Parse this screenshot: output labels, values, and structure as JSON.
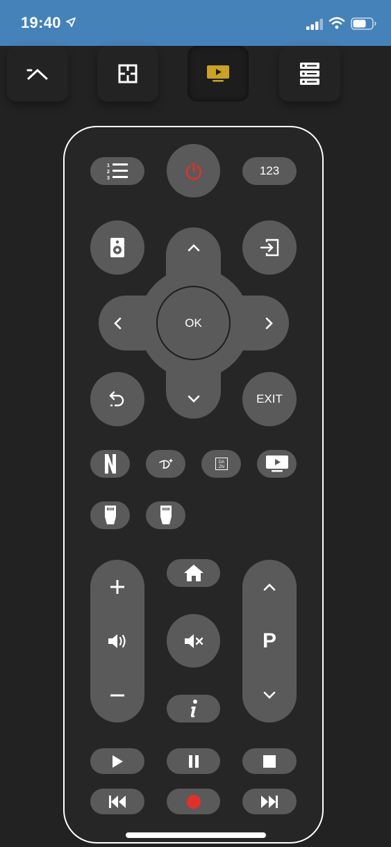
{
  "status_bar": {
    "time": "19:40"
  },
  "remote": {
    "numbers_label": "123",
    "ok_label": "OK",
    "exit_label": "EXIT",
    "channel_label": "P",
    "dazn_line1": "DA",
    "dazn_line2": "ZN"
  },
  "icons": {
    "top_nav": [
      "collapse-chevron-icon",
      "floorplan-icon",
      "tv-icon",
      "server-list-icon"
    ],
    "apps": [
      "netflix-icon",
      "disney-plus-icon",
      "dazn-icon",
      "tv-app-icon"
    ],
    "hdmi": [
      "hdmi-1-icon",
      "hdmi-2-icon"
    ]
  },
  "colors": {
    "status_bar": "#4582b9",
    "background": "#222222",
    "button": "#5a5a5a",
    "power": "#e0302b",
    "record": "#e0302b",
    "active_tab": "#c9a227"
  }
}
